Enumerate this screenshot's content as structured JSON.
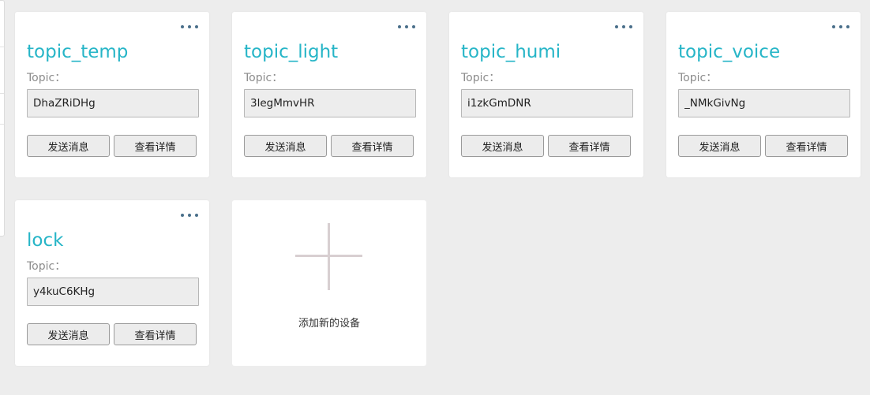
{
  "devices": [
    {
      "name": "topic_temp",
      "topic_label": "Topic：",
      "topic_value": "DhaZRiDHg",
      "send_label": "发送消息",
      "detail_label": "查看详情"
    },
    {
      "name": "topic_light",
      "topic_label": "Topic：",
      "topic_value": "3legMmvHR",
      "send_label": "发送消息",
      "detail_label": "查看详情"
    },
    {
      "name": "topic_humi",
      "topic_label": "Topic：",
      "topic_value": "i1zkGmDNR",
      "send_label": "发送消息",
      "detail_label": "查看详情"
    },
    {
      "name": "topic_voice",
      "topic_label": "Topic：",
      "topic_value": "_NMkGivNg",
      "send_label": "发送消息",
      "detail_label": "查看详情"
    },
    {
      "name": "lock",
      "topic_label": "Topic：",
      "topic_value": "y4kuC6KHg",
      "send_label": "发送消息",
      "detail_label": "查看详情"
    }
  ],
  "add_device": {
    "label": "添加新的设备",
    "icon": "plus-icon"
  },
  "icons": {
    "more": "more-dots-icon"
  },
  "colors": {
    "page_background": "#ededed",
    "card_background": "#ffffff",
    "title": "#26b5c7",
    "more_dots": "#4a6f8a",
    "plus": "#d8cfd1",
    "field_background": "#ededed"
  }
}
